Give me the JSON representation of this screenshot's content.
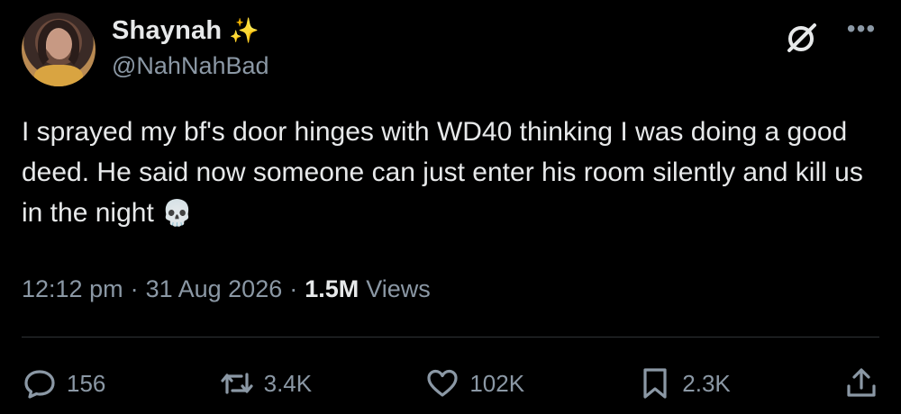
{
  "author": {
    "display_name": "Shaynah",
    "badge_emoji": "✨",
    "handle": "@NahNahBad"
  },
  "tweet": {
    "text": "I sprayed my bf's door hinges with WD40 thinking I was doing a good deed. He said now someone can just enter his room silently and kill us in the night",
    "emoji": "💀",
    "time": "12:12 pm",
    "separator": "·",
    "date": "31 Aug 2026",
    "views_count": "1.5M",
    "views_label": "Views"
  },
  "actions": {
    "reply_count": "156",
    "repost_count": "3.4K",
    "like_count": "102K",
    "bookmark_count": "2.3K"
  },
  "icons": {
    "grok": "grok-icon",
    "more": "more-icon",
    "reply": "reply-icon",
    "repost": "repost-icon",
    "like": "like-icon",
    "bookmark": "bookmark-icon",
    "share": "share-icon"
  },
  "colors": {
    "background": "#000000",
    "text": "#e7e9ea",
    "secondary_text": "#8b98a5",
    "divider": "#2f3336"
  }
}
